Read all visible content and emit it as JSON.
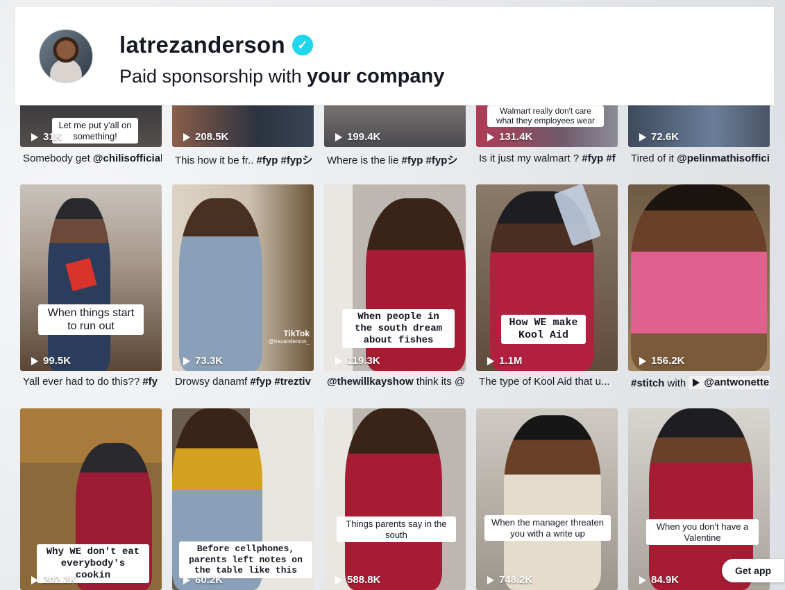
{
  "header": {
    "username": "latrezanderson",
    "sponsorship_prefix": "Paid sponsorship with ",
    "sponsorship_company": "your company"
  },
  "videos": [
    {
      "views": "31K",
      "caption": "Somebody get ",
      "caption_bold": "@chilisofficial",
      "overlay": "Let me put y'all on something!"
    },
    {
      "views": "208.5K",
      "caption": "This how it be fr.. ",
      "caption_bold": "#fyp #fypシ",
      "overlay": ""
    },
    {
      "views": "199.4K",
      "caption": "Where is the lie ",
      "caption_bold": "#fyp #fypシ",
      "overlay": ""
    },
    {
      "views": "131.4K",
      "caption": "Is it just my walmart ? ",
      "caption_bold": "#fyp #f",
      "overlay": "Walmart really don't care what they employees wear"
    },
    {
      "views": "72.6K",
      "caption": "Tired of it ",
      "caption_bold": "@pelinmathisofficial",
      "overlay": ""
    },
    {
      "views": "99.5K",
      "caption": "Yall ever had to do this?? ",
      "caption_bold": "#fy",
      "overlay": "When things start to run out"
    },
    {
      "views": "73.3K",
      "caption": "Drowsy danamf ",
      "caption_bold": "#fyp #treztiv",
      "overlay": "",
      "watermark": "TikTok",
      "watermark_handle": "@trezanderson_"
    },
    {
      "views": "119.3K",
      "caption": "",
      "caption_bold_first": "@thewillkayshow",
      "caption_rest": " think its @p",
      "overlay": "When people in the south dream about fishes"
    },
    {
      "views": "1.1M",
      "caption": "The type of Kool Aid that u...",
      "caption_bold": "",
      "overlay": "How WE make Kool Aid"
    },
    {
      "views": "156.2K",
      "caption_bold_first": "#stitch",
      "caption_rest": " with ",
      "caption_pill": "@antwonette",
      "overlay": ""
    },
    {
      "views": "202.2K",
      "overlay": "Why WE don't eat everybody's cookin"
    },
    {
      "views": "60.2K",
      "overlay": "Before cellphones, parents left notes on the table like this"
    },
    {
      "views": "588.8K",
      "overlay": "Things parents say in the south"
    },
    {
      "views": "748.2K",
      "overlay": "When the manager threaten you with a write up"
    },
    {
      "views": "84.9K",
      "overlay": "When you don't have a Valentine"
    }
  ],
  "get_app": "Get app",
  "colors": {
    "verified": "#20d5ec",
    "text": "#161823"
  }
}
